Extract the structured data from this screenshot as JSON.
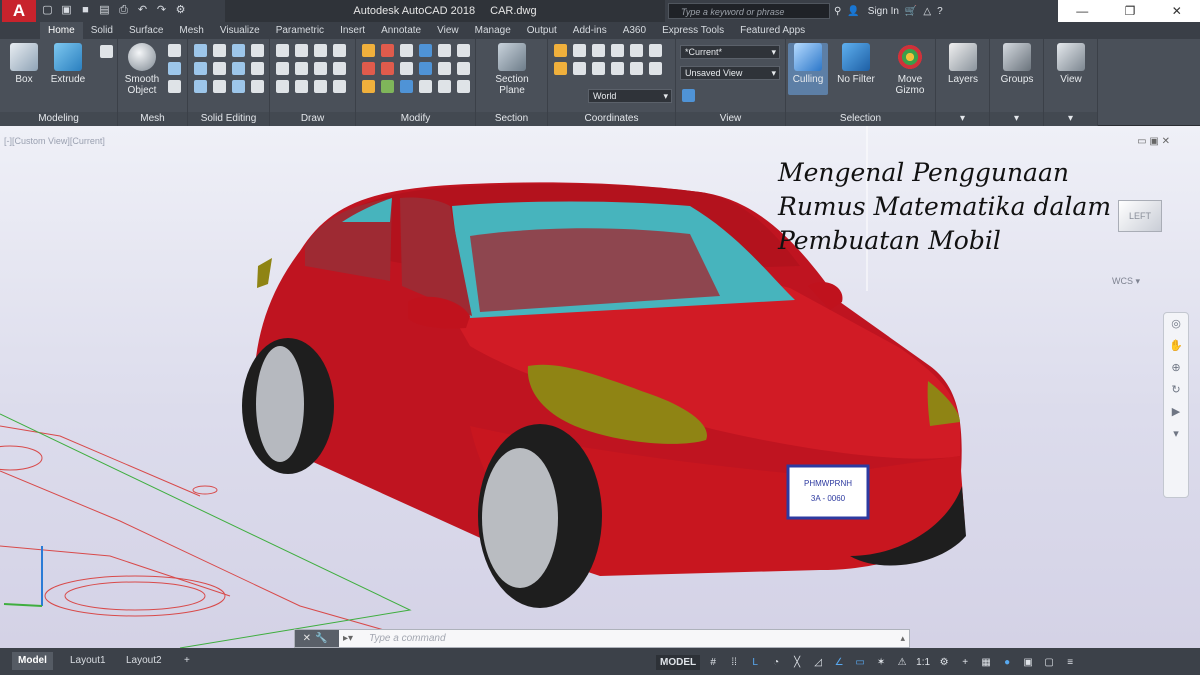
{
  "titlebar": {
    "app_name": "Autodesk AutoCAD 2018",
    "file_name": "CAR.dwg",
    "search_placeholder": "Type a keyword or phrase",
    "sign_in": "Sign In",
    "logo_letter": "A"
  },
  "tabs": [
    "Home",
    "Solid",
    "Surface",
    "Mesh",
    "Visualize",
    "Parametric",
    "Insert",
    "Annotate",
    "View",
    "Manage",
    "Output",
    "Add-ins",
    "A360",
    "Express Tools",
    "Featured Apps"
  ],
  "ribbon": {
    "modeling": {
      "box": "Box",
      "extrude": "Extrude",
      "footer": "Modeling"
    },
    "mesh": {
      "smooth": "Smooth Object",
      "footer": "Mesh"
    },
    "solid_editing": {
      "footer": "Solid Editing"
    },
    "draw": {
      "footer": "Draw"
    },
    "modify": {
      "footer": "Modify"
    },
    "section": {
      "plane": "Section Plane",
      "footer": "Section"
    },
    "coordinates": {
      "ucs": "World",
      "footer": "Coordinates"
    },
    "view": {
      "visual_style": "*Current*",
      "named_view": "Unsaved View",
      "footer": "View"
    },
    "selection": {
      "culling": "Culling",
      "filter": "No Filter",
      "gizmo": "Move Gizmo",
      "footer": "Selection"
    },
    "layers": "Layers",
    "groups": "Groups",
    "view_btn": "View"
  },
  "viewport": {
    "label": "[-][Custom View][Current]",
    "viewcube_face": "LEFT",
    "wcs_label": "WCS",
    "overlay_title": [
      "Mengenal Penggunaan",
      "Rumus Matematika dalam",
      "Pembuatan Mobil"
    ],
    "license_plate": [
      "PHMWPRNH",
      "3A - 0060"
    ]
  },
  "command_line": {
    "placeholder": "Type a command"
  },
  "status_bar": {
    "layouts": [
      "Model",
      "Layout1",
      "Layout2"
    ],
    "model_space": "MODEL",
    "annotation_scale": "1:1"
  },
  "colors": {
    "car_red": "#d01822",
    "glass": "#47b4bd",
    "headlight": "#9c8b14",
    "viewport_bg": "#e2e2ef",
    "ribbon_bg": "#4a5059",
    "title_bg": "#3a3f47"
  }
}
